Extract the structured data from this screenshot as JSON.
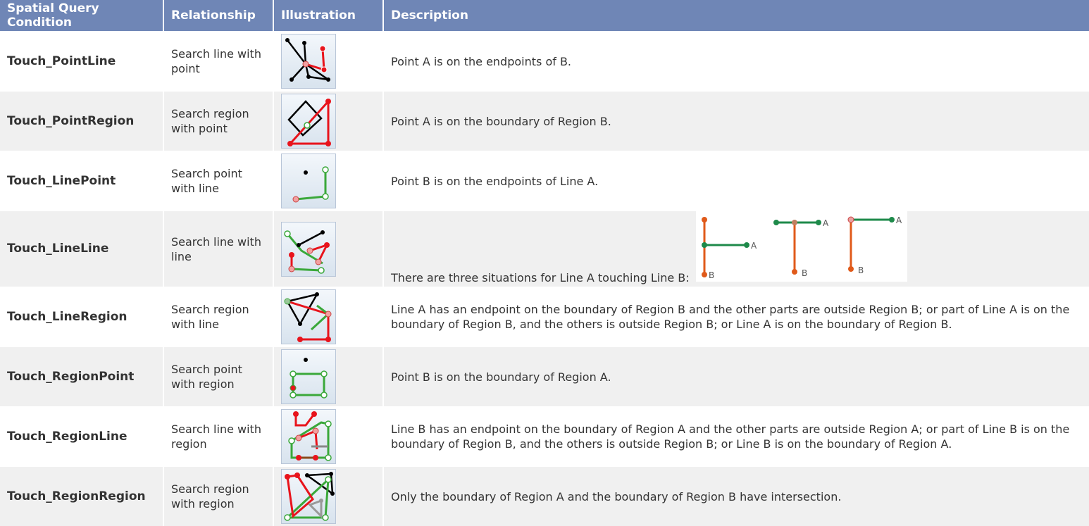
{
  "headers": {
    "condition": "Spatial Query Condition",
    "relationship": "Relationship",
    "illustration": "Illustration",
    "description": "Description"
  },
  "rows": [
    {
      "condition": "Touch_PointLine",
      "relationship": "Search line with point",
      "illustration_icon": "point-line-touch-icon",
      "description": "Point A is on the endpoints of B."
    },
    {
      "condition": "Touch_PointRegion",
      "relationship": "Search region with point",
      "illustration_icon": "point-region-touch-icon",
      "description": "Point A is on the boundary of Region B."
    },
    {
      "condition": "Touch_LinePoint",
      "relationship": "Search point with line",
      "illustration_icon": "line-point-touch-icon",
      "description": "Point B is on the endpoints of Line A."
    },
    {
      "condition": "Touch_LineLine",
      "relationship": "Search line with line",
      "illustration_icon": "line-line-touch-icon",
      "description": "There are three situations for Line A touching Line B:",
      "figure_labels": [
        "A",
        "B",
        "A",
        "B",
        "A",
        "B"
      ]
    },
    {
      "condition": "Touch_LineRegion",
      "relationship": "Search region with line",
      "illustration_icon": "line-region-touch-icon",
      "description": "Line A has an endpoint on the boundary of Region B and the other parts are outside Region B; or part of Line A is on the boundary of Region B, and the others is outside Region B; or Line A is on the boundary of Region B."
    },
    {
      "condition": "Touch_RegionPoint",
      "relationship": "Search point with region",
      "illustration_icon": "region-point-touch-icon",
      "description": "Point B is on the boundary of Region A."
    },
    {
      "condition": "Touch_RegionLine",
      "relationship": "Search line with region",
      "illustration_icon": "region-line-touch-icon",
      "description": "Line B has an endpoint on the boundary of Region A and the other parts are outside Region A; or part of Line B is on the boundary of Region B, and the others is outside Region B; or Line B is on the boundary of Region A."
    },
    {
      "condition": "Touch_RegionRegion",
      "relationship": "Search region with region",
      "illustration_icon": "region-region-touch-icon",
      "description": "Only the boundary of Region A and the boundary of Region B have intersection."
    }
  ],
  "colors": {
    "header_bg": "#6f86b6",
    "row_alt_bg": "#f0f0f0",
    "red": "#e8141c",
    "green": "#3aa83a",
    "orange": "#e05a1a",
    "dark_green": "#1e8a4a"
  }
}
